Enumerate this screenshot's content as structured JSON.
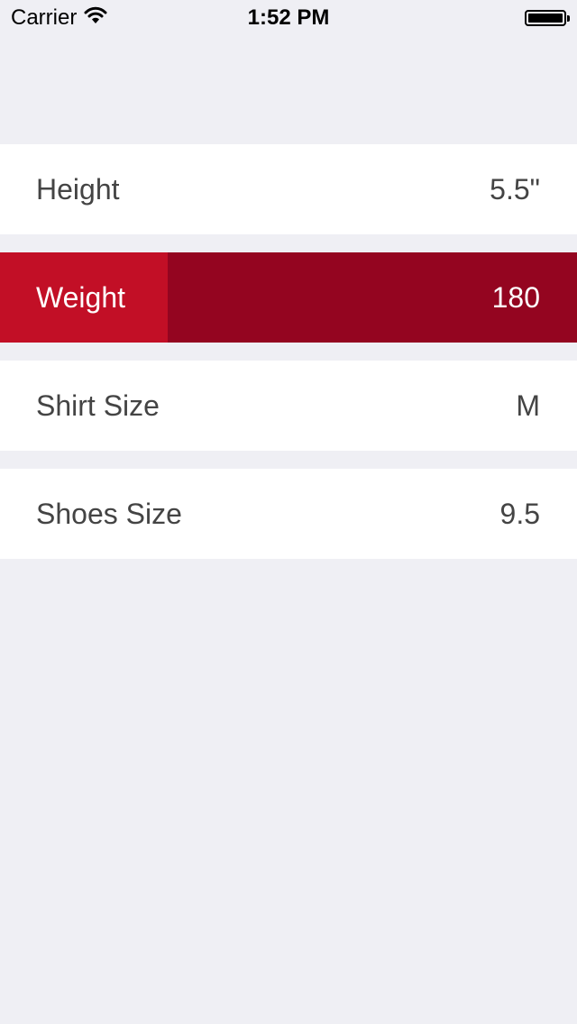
{
  "status_bar": {
    "carrier": "Carrier",
    "time": "1:52 PM",
    "icons": [
      "wifi-icon",
      "battery-icon"
    ]
  },
  "colors": {
    "background": "#EFEFF4",
    "row_background": "#FFFFFF",
    "text": "#444444",
    "selected_label_bg": "#C20F26",
    "selected_value_bg": "#940520",
    "selected_text": "#FFFFFF"
  },
  "rows": [
    {
      "label": "Height",
      "value": "5.5\"",
      "selected": false
    },
    {
      "label": "Weight",
      "value": "180",
      "selected": true
    },
    {
      "label": "Shirt Size",
      "value": "M",
      "selected": false
    },
    {
      "label": "Shoes Size",
      "value": "9.5",
      "selected": false
    }
  ]
}
